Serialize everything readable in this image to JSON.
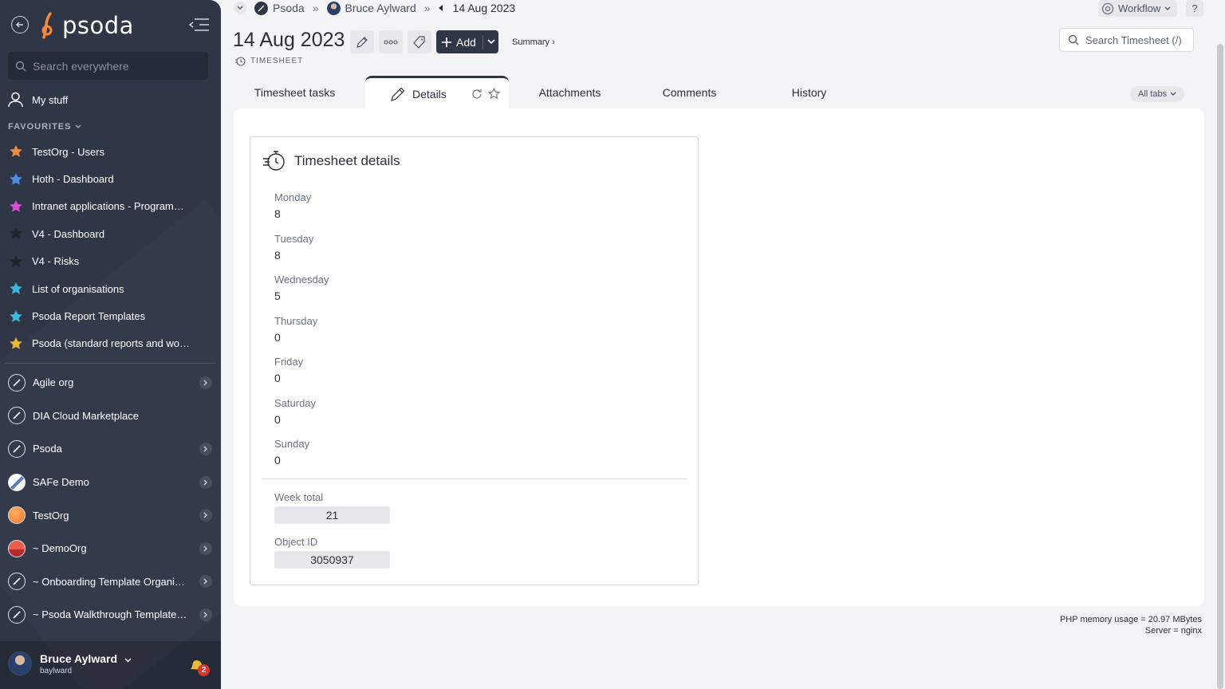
{
  "sidebar": {
    "logo_text": "psoda",
    "search_placeholder": "Search everywhere",
    "my_stuff": "My stuff",
    "favourites_header": "FAVOURITES",
    "favourites": [
      {
        "label": "TestOrg - Users",
        "star_color": "#f08a3c"
      },
      {
        "label": "Hoth - Dashboard",
        "star_color": "#4a90e2"
      },
      {
        "label": "Intranet applications - Programme...",
        "star_color": "#d84fd1"
      },
      {
        "label": "V4 - Dashboard",
        "star_color": "#1f232b"
      },
      {
        "label": "V4 - Risks",
        "star_color": "#1f232b"
      },
      {
        "label": "List of organisations",
        "star_color": "#3bb7d9"
      },
      {
        "label": "Psoda Report Templates",
        "star_color": "#3bb7d9"
      },
      {
        "label": "Psoda (standard reports and work...",
        "star_color": "#e8b93a"
      }
    ],
    "orgs": [
      {
        "label": "Agile org",
        "icon": "psoda-org-icon",
        "has_chevron": true
      },
      {
        "label": "DIA Cloud Marketplace",
        "icon": "psoda-org-icon",
        "has_chevron": false
      },
      {
        "label": "Psoda",
        "icon": "psoda-org-icon",
        "has_chevron": true
      },
      {
        "label": "SAFe Demo",
        "icon": "mountain-org-icon",
        "has_chevron": true
      },
      {
        "label": "TestOrg",
        "icon": "orange-org-icon",
        "has_chevron": true
      },
      {
        "label": "~ DemoOrg",
        "icon": "sunset-org-icon",
        "has_chevron": true
      },
      {
        "label": "~ Onboarding Template Organisa...",
        "icon": "psoda-org-icon",
        "has_chevron": true
      },
      {
        "label": "~ Psoda Walkthrough Template P...",
        "icon": "psoda-org-icon",
        "has_chevron": true
      }
    ],
    "user": {
      "name": "Bruce Aylward",
      "handle": "baylward",
      "notifications": "2"
    }
  },
  "breadcrumb": {
    "org": "Psoda",
    "user": "Bruce Aylward",
    "current": "14 Aug 2023"
  },
  "header": {
    "workflow_label": "Workflow",
    "help_label": "?",
    "title": "14 Aug 2023",
    "add_label": "Add",
    "summary_label": "Summary ›",
    "object_type": "TIMESHEET",
    "search_placeholder": "Search Timesheet (/)"
  },
  "tabs": {
    "items": [
      "Timesheet tasks",
      "Details",
      "Attachments",
      "Comments",
      "History"
    ],
    "active": "Details",
    "all_tabs_label": "All tabs"
  },
  "details": {
    "card_title": "Timesheet details",
    "days": [
      {
        "label": "Monday",
        "value": "8"
      },
      {
        "label": "Tuesday",
        "value": "8"
      },
      {
        "label": "Wednesday",
        "value": "5"
      },
      {
        "label": "Thursday",
        "value": "0"
      },
      {
        "label": "Friday",
        "value": "0"
      },
      {
        "label": "Saturday",
        "value": "0"
      },
      {
        "label": "Sunday",
        "value": "0"
      }
    ],
    "week_total_label": "Week total",
    "week_total": "21",
    "object_id_label": "Object ID",
    "object_id": "3050937"
  },
  "footer": {
    "memory": "PHP memory usage = 20.97 MBytes",
    "server": "Server = nginx"
  }
}
